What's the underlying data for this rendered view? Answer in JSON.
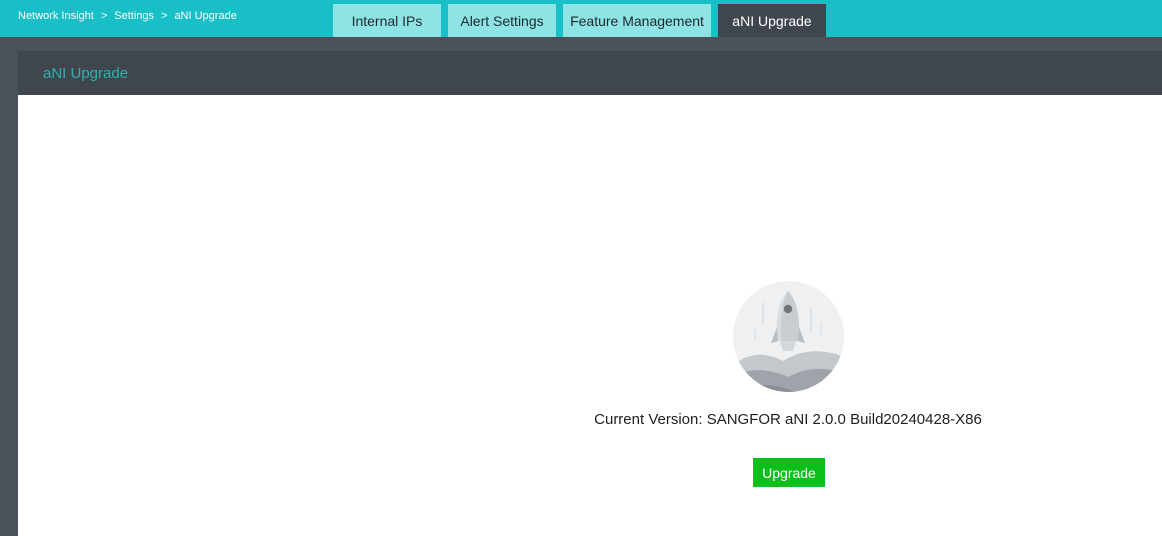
{
  "breadcrumb": {
    "items": [
      "Network Insight",
      "Settings",
      "aNI Upgrade"
    ],
    "separator": ">"
  },
  "tabs": [
    {
      "label": "Internal IPs",
      "active": false
    },
    {
      "label": "Alert Settings",
      "active": false
    },
    {
      "label": "Feature Management",
      "active": false
    },
    {
      "label": "aNI Upgrade",
      "active": true
    }
  ],
  "panel": {
    "title": "aNI Upgrade"
  },
  "upgrade": {
    "illustration": "rocket-icon",
    "version_text": "Current Version: SANGFOR aNI 2.0.0 Build20240428-X86",
    "button_label": "Upgrade"
  },
  "colors": {
    "topbar": "#19bfc6",
    "tab_inactive": "#8ee3e4",
    "tab_active": "#3f464d",
    "panel_title": "#2fb1ae",
    "upgrade_button": "#0cbf1b"
  }
}
